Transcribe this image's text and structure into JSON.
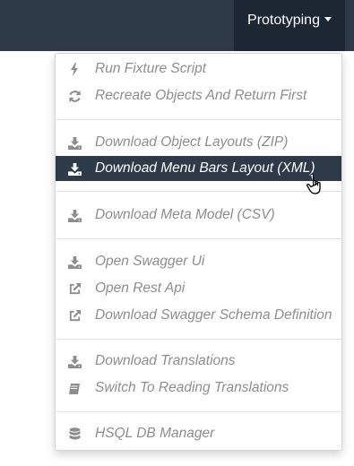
{
  "navbar": {
    "menu_label": "Prototyping"
  },
  "menu": {
    "items": [
      {
        "label": "Run Fixture Script",
        "icon": "bolt-icon"
      },
      {
        "label": "Recreate Objects And Return First",
        "icon": "refresh-icon"
      },
      {
        "label": "Download Object Layouts (ZIP)",
        "icon": "download-icon"
      },
      {
        "label": "Download Menu Bars Layout (XML)",
        "icon": "download-icon",
        "active": true
      },
      {
        "label": "Download Meta Model (CSV)",
        "icon": "download-icon"
      },
      {
        "label": "Open Swagger Ui",
        "icon": "download-icon"
      },
      {
        "label": "Open Rest Api",
        "icon": "external-link-icon"
      },
      {
        "label": "Download Swagger Schema Definition",
        "icon": "external-link-icon"
      },
      {
        "label": "Download Translations",
        "icon": "download-icon"
      },
      {
        "label": "Switch To Reading Translations",
        "icon": "book-icon"
      },
      {
        "label": "HSQL DB Manager",
        "icon": "database-icon"
      }
    ]
  },
  "colors": {
    "navbar_bg": "#2e3a48",
    "navbar_active_bg": "#1d2633",
    "item_text": "#8d8d8d",
    "active_bg": "#2e3a48",
    "active_text": "#ffffff"
  }
}
